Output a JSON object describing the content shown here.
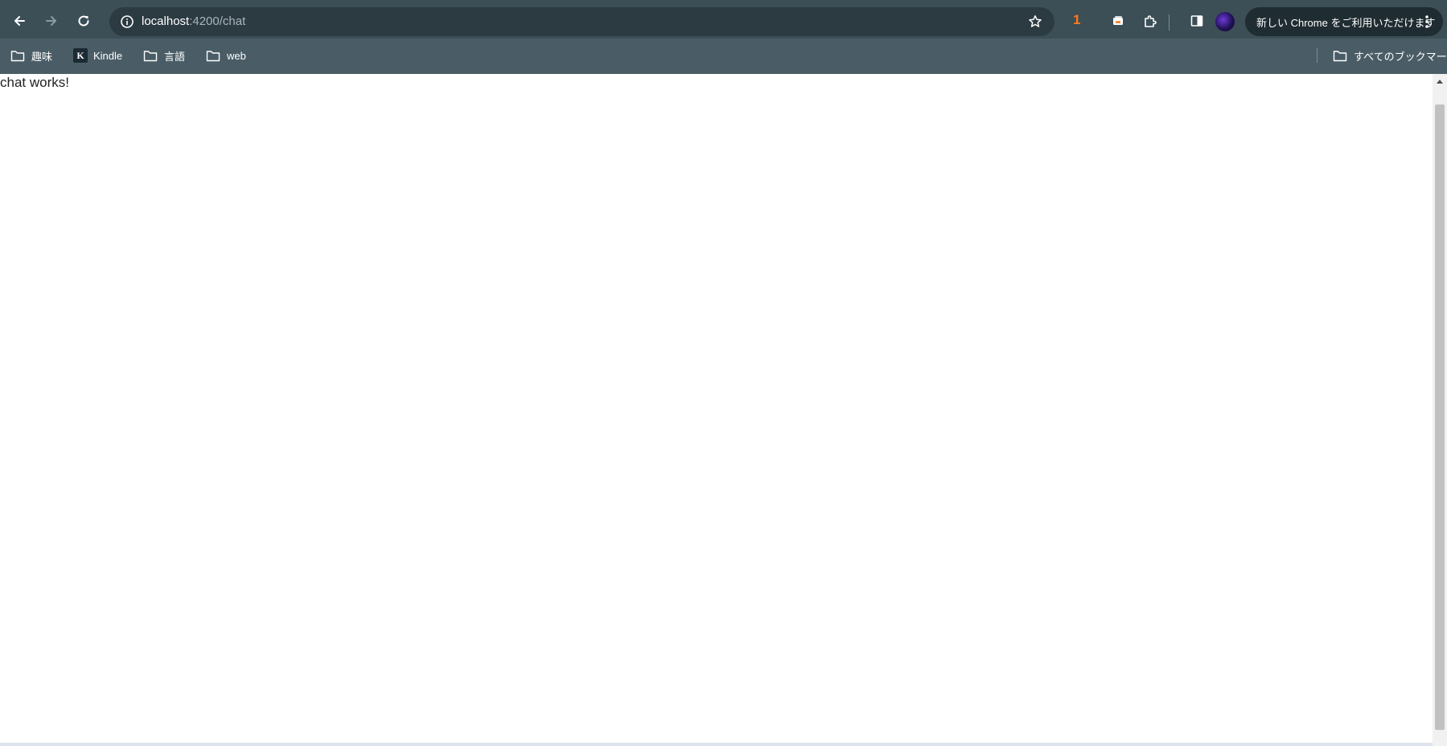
{
  "browser": {
    "url_host": "localhost",
    "url_path": ":4200/chat",
    "extension_badge": "1",
    "update_button_label": "新しい Chrome をご利用いただけます",
    "colors": {
      "toolbar": "#3c4e56",
      "bookmarks_bar": "#4a5d66",
      "omnibox": "#2c3b42",
      "extension_badge": "#ff7a1a"
    },
    "icons": [
      "back-arrow-icon",
      "forward-arrow-icon",
      "reload-icon",
      "site-info-icon",
      "bookmark-star-icon",
      "extension-icon",
      "puzzle-extensions-icon",
      "side-panel-icon",
      "profile-avatar",
      "more-menu-icon"
    ]
  },
  "bookmarks": {
    "items": [
      {
        "label": "趣味",
        "icon": "folder-icon"
      },
      {
        "label": "Kindle",
        "icon": "kindle-icon"
      },
      {
        "label": "言語",
        "icon": "folder-icon"
      },
      {
        "label": "web",
        "icon": "folder-icon"
      }
    ],
    "all_bookmarks_label": "すべてのブックマーク"
  },
  "page": {
    "text": "chat works!"
  }
}
